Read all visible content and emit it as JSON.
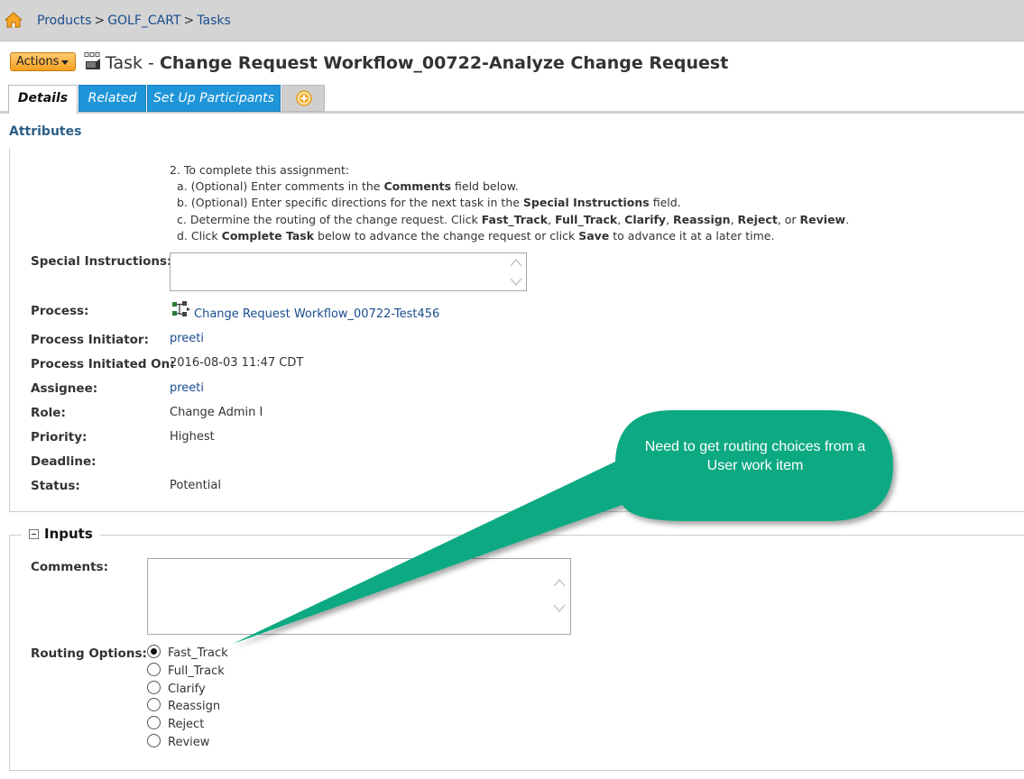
{
  "breadcrumb": {
    "items": [
      "Products",
      "GOLF_CART",
      "Tasks"
    ],
    "separator": ">"
  },
  "header": {
    "actions_label": "Actions",
    "title_prefix": "Task -",
    "title": "Change Request Workflow_00722-Analyze Change Request"
  },
  "tabs": [
    {
      "label": "Details",
      "active": true
    },
    {
      "label": "Related",
      "active": false
    },
    {
      "label": "Set Up Participants",
      "active": false
    }
  ],
  "attributes": {
    "heading": "Attributes",
    "instructions": {
      "intro": "2. To complete this assignment:",
      "a_pre": "a. (Optional) Enter comments in the ",
      "a_bold": "Comments",
      "a_post": " field below.",
      "b_pre": "b. (Optional) Enter specific directions for the next task in the ",
      "b_bold": "Special Instructions",
      "b_post": " field.",
      "c_pre": "c. Determine the routing of the change request. Click ",
      "c_opts": [
        "Fast_Track",
        "Full_Track",
        "Clarify",
        "Reassign",
        "Reject",
        "Review"
      ],
      "c_sep": ", ",
      "c_or": "or ",
      "c_end": ".",
      "d_pre": "d. Click ",
      "d_bold1": "Complete Task",
      "d_mid": " below to advance the change request or click ",
      "d_bold2": "Save",
      "d_post": " to advance it at a later time."
    },
    "special_instructions_label": "Special Instructions:",
    "special_instructions_value": "",
    "process_label": "Process:",
    "process_value": "Change Request Workflow_00722-Test456",
    "initiator_label": "Process Initiator:",
    "initiator_value": "preeti",
    "initiated_on_label": "Process Initiated On:",
    "initiated_on_value": "2016-08-03 11:47 CDT",
    "assignee_label": "Assignee:",
    "assignee_value": "preeti",
    "role_label": "Role:",
    "role_value": "Change Admin I",
    "priority_label": "Priority:",
    "priority_value": "Highest",
    "deadline_label": "Deadline:",
    "deadline_value": "",
    "status_label": "Status:",
    "status_value": "Potential"
  },
  "inputs": {
    "title": "Inputs",
    "comments_label": "Comments:",
    "comments_value": "",
    "routing_label": "Routing Options:",
    "routing_options": [
      {
        "label": "Fast_Track",
        "checked": true
      },
      {
        "label": "Full_Track",
        "checked": false
      },
      {
        "label": "Clarify",
        "checked": false
      },
      {
        "label": "Reassign",
        "checked": false
      },
      {
        "label": "Reject",
        "checked": false
      },
      {
        "label": "Review",
        "checked": false
      }
    ]
  },
  "callout": {
    "text": "Need to get routing choices from a User work item",
    "color": "#0aa982"
  },
  "colors": {
    "tab_blue": "#1e95d8",
    "actions_orange": "#f5a020",
    "link_blue": "#1a4d8f"
  }
}
